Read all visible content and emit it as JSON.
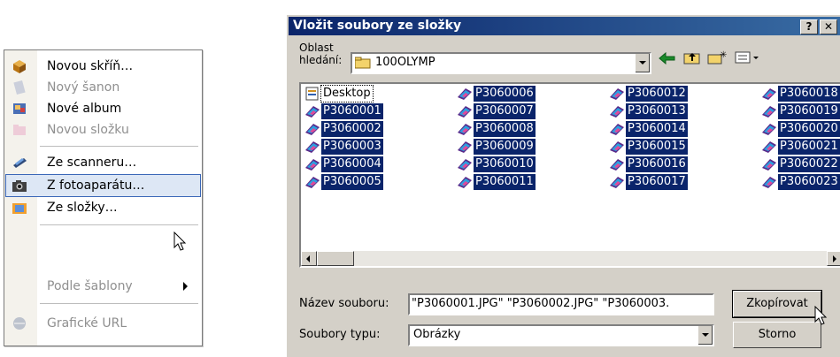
{
  "menu": {
    "items": [
      {
        "label": "Novou skříň…",
        "disabled": false,
        "icon": "cabinet-icon"
      },
      {
        "label": "Nový šanon",
        "disabled": true,
        "icon": "binder-icon"
      },
      {
        "label": "Nové album",
        "disabled": false,
        "icon": "album-icon"
      },
      {
        "label": "Novou složku",
        "disabled": true,
        "icon": "folder-icon"
      },
      {
        "label": "Ze scanneru…",
        "disabled": false,
        "icon": "scanner-icon"
      },
      {
        "label": "Z fotoaparátu…",
        "disabled": false,
        "icon": "camera-icon",
        "highlighted": true
      },
      {
        "label": "Ze složky…",
        "disabled": false,
        "icon": "folder-photo-icon"
      },
      {
        "label": "Podle šablony",
        "disabled": true,
        "icon": "",
        "submenu": true
      },
      {
        "label": "Grafické URL",
        "disabled": true,
        "icon": "web-image-icon"
      }
    ]
  },
  "dialog": {
    "title": "Vložit soubory ze složky",
    "help_label": "?",
    "close_label": "✕",
    "look_in_label": "Oblast\nhledání:",
    "look_in_value": "100OLYMP",
    "files": [
      "Desktop",
      "P3060001",
      "P3060002",
      "P3060003",
      "P3060004",
      "P3060005",
      "P3060006",
      "P3060007",
      "P3060008",
      "P3060009",
      "P3060010",
      "P3060011",
      "P3060012",
      "P3060013",
      "P3060014",
      "P3060015",
      "P3060016",
      "P3060017",
      "P3060018",
      "P3060019",
      "P3060020",
      "P3060021",
      "P3060022",
      "P3060023"
    ],
    "filename_label": "Název souboru:",
    "filename_value": "\"P3060001.JPG\" \"P3060002.JPG\" \"P3060003.",
    "filetype_label": "Soubory typu:",
    "filetype_value": "Obrázky",
    "copy_button": "Zkopírovat",
    "cancel_button": "Storno"
  }
}
